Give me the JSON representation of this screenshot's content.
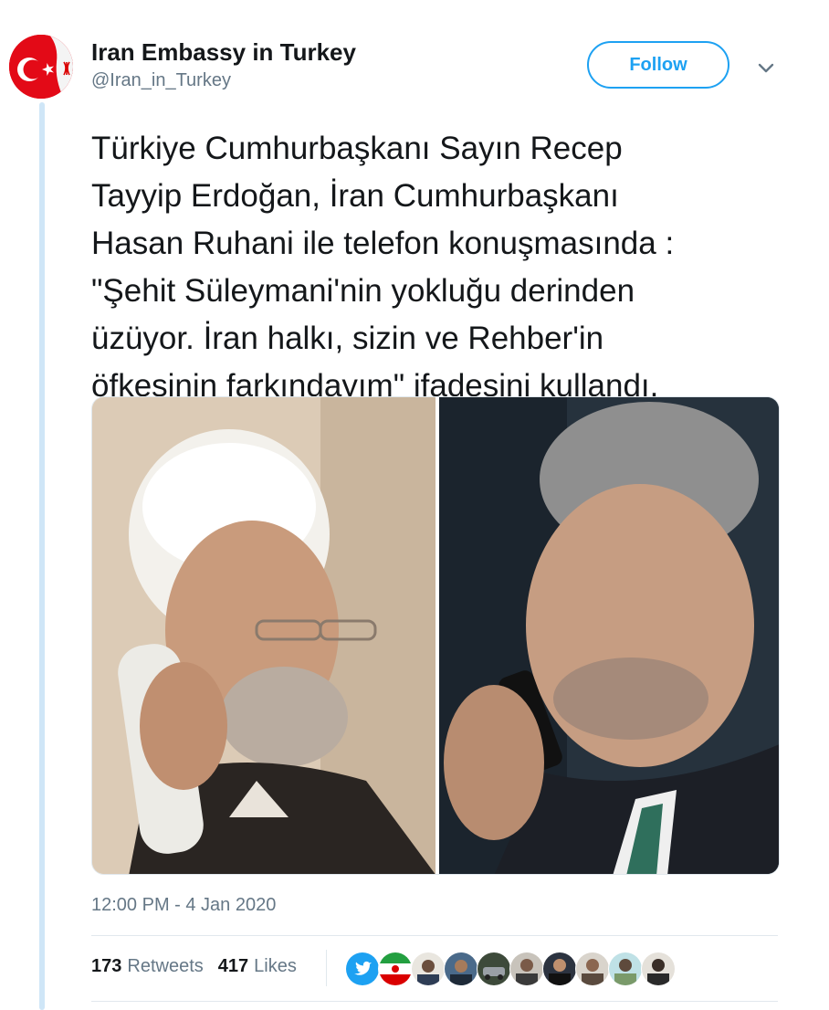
{
  "author": {
    "display_name": "Iran Embassy in Turkey",
    "handle": "@Iran_in_Turkey",
    "avatar_icon": "turkey-iran-flags-avatar"
  },
  "actions": {
    "follow_label": "Follow",
    "more_icon": "chevron-down-icon"
  },
  "tweet": {
    "text_lines": [
      "Türkiye Cumhurbaşkanı Sayın Recep",
      "Tayyip Erdoğan, İran Cumhurbaşkanı",
      "Hasan Ruhani ile telefon konuşmasında :",
      "\"Şehit Süleymani'nin yokluğu derinden",
      "üzüyor. İran halkı, sizin ve Rehber'in",
      "öfkesinin farkındayım\" ifadesini kullandı."
    ],
    "timestamp": "12:00 PM - 4 Jan 2020"
  },
  "stats": {
    "retweets_count": "173",
    "retweets_label": "Retweets",
    "likes_count": "417",
    "likes_label": "Likes"
  },
  "colors": {
    "accent": "#1da1f2",
    "text": "#14171a",
    "muted": "#657786",
    "thread_line": "#cfe6f7"
  }
}
